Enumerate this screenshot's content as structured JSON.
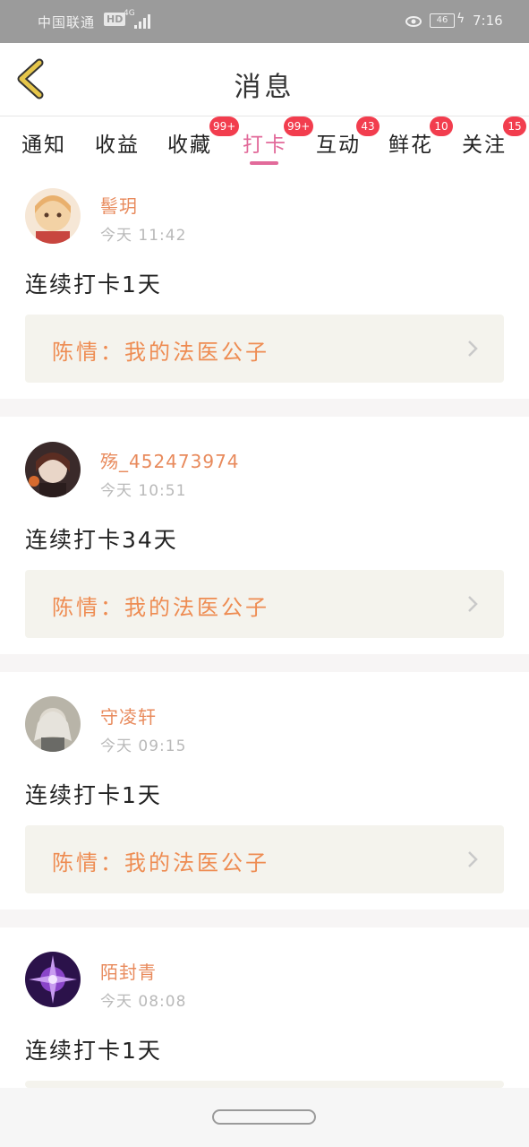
{
  "status_bar": {
    "carrier": "中国联通",
    "hd": "HD",
    "network": "4G",
    "battery": "46",
    "time": "7:16"
  },
  "header": {
    "title": "消息",
    "back_icon": "chevron-left-icon"
  },
  "tabs": [
    {
      "label": "通知",
      "badge": ""
    },
    {
      "label": "收益",
      "badge": ""
    },
    {
      "label": "收藏",
      "badge": "99+"
    },
    {
      "label": "打卡",
      "badge": "99+",
      "active": true
    },
    {
      "label": "互动",
      "badge": "43"
    },
    {
      "label": "鲜花",
      "badge": "10"
    },
    {
      "label": "关注",
      "badge": "15"
    }
  ],
  "items": [
    {
      "username": "髻玥",
      "time": "今天 11:42",
      "message": "连续打卡1天",
      "link": "陈情：我的法医公子"
    },
    {
      "username": "殇_452473974",
      "time": "今天 10:51",
      "message": "连续打卡34天",
      "link": "陈情：我的法医公子"
    },
    {
      "username": "守凌轩",
      "time": "今天 09:15",
      "message": "连续打卡1天",
      "link": "陈情：我的法医公子"
    },
    {
      "username": "陌封青",
      "time": "今天 08:08",
      "message": "连续打卡1天",
      "link": ""
    }
  ],
  "colors": {
    "accent": "#e26a9a",
    "badge": "#f23d4e",
    "username": "#e88a5c",
    "link_text": "#ee8c52",
    "back_icon": "#e6c64a"
  }
}
